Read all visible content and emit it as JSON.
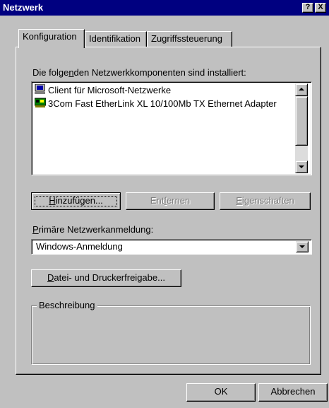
{
  "window": {
    "title": "Netzwerk"
  },
  "caption_buttons": {
    "help": "?",
    "close": "X"
  },
  "tabs": [
    {
      "label": "Konfiguration",
      "active": true
    },
    {
      "label": "Identifikation",
      "active": false
    },
    {
      "label": "Zugriffssteuerung",
      "active": false
    }
  ],
  "components": {
    "label_pre": "Die folge",
    "label_mnemonic": "n",
    "label_post": "den Netzwerkkomponenten sind installiert:",
    "items": [
      {
        "icon": "client-network-icon",
        "label": "Client für Microsoft-Netzwerke"
      },
      {
        "icon": "network-adapter-icon",
        "label": "3Com Fast EtherLink XL 10/100Mb TX Ethernet Adapter"
      }
    ]
  },
  "buttons": {
    "add_mnemonic": "H",
    "add_rest": "inzufügen...",
    "remove_pre": "Ent",
    "remove_mnemonic": "f",
    "remove_post": "ernen",
    "properties_mnemonic": "E",
    "properties_rest": "igenschaften",
    "file_print_mnemonic": "D",
    "file_print_rest": "atei- und Druckerfreigabe...",
    "ok": "OK",
    "cancel": "Abbrechen"
  },
  "primary_logon": {
    "label_mnemonic": "P",
    "label_rest": "rimäre Netzwerkanmeldung:",
    "value": "Windows-Anmeldung"
  },
  "description": {
    "label": "Beschreibung"
  },
  "colors": {
    "titlebar": "#000080",
    "face": "#c0c0c0",
    "disabled_text": "#808080"
  }
}
